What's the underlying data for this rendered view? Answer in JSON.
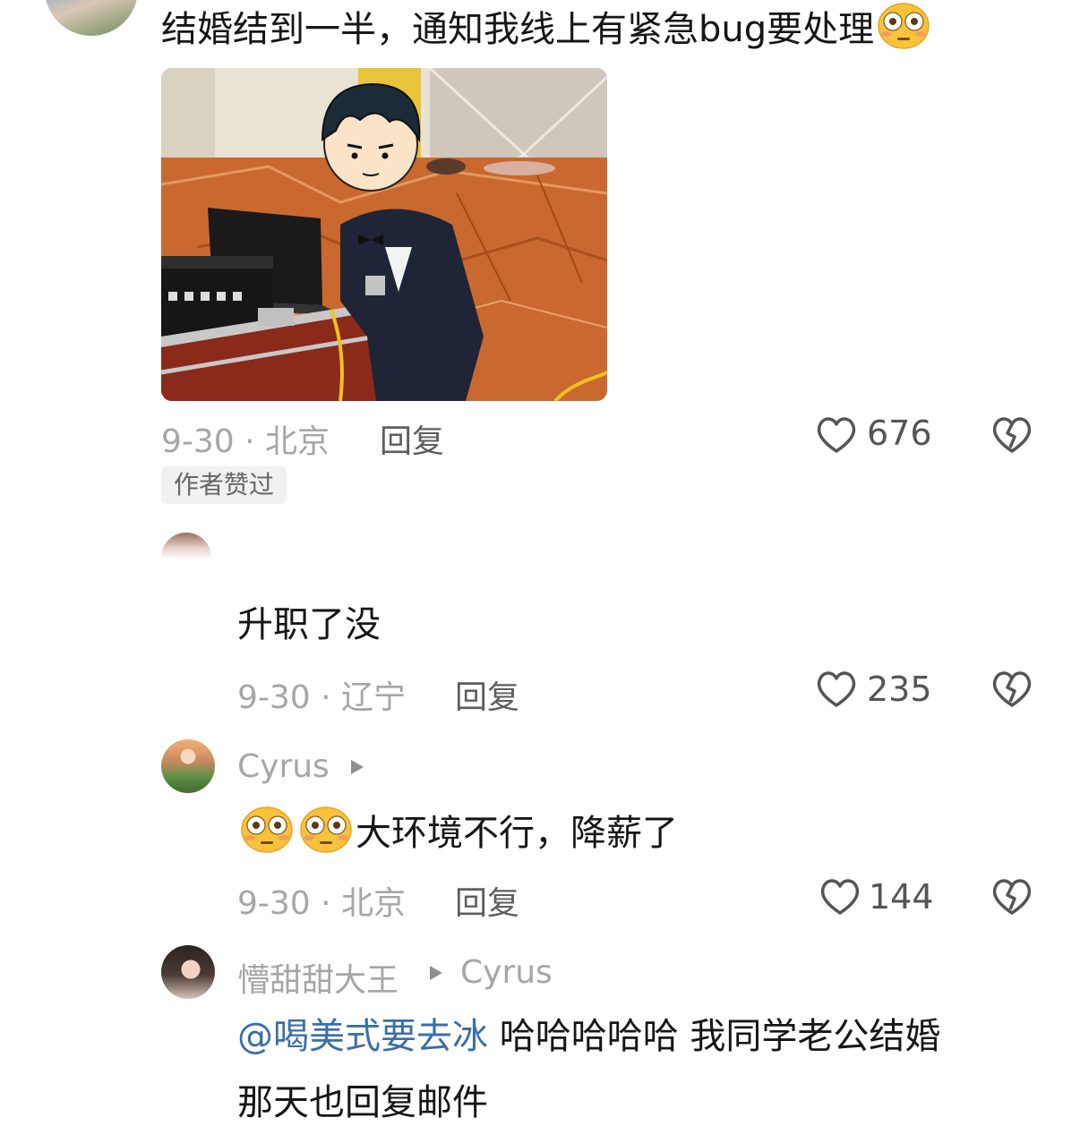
{
  "comments": [
    {
      "text": "结婚结到一半，通知我线上有紧急bug要处理",
      "emoji": "flushed-face",
      "meta": "9-30 · 北京",
      "reply_label": "回复",
      "likes": "676",
      "tag": "作者赞过",
      "has_image": true
    },
    {
      "text": "升职了没",
      "meta": "9-30 · 辽宁",
      "reply_label": "回复",
      "likes": "235"
    },
    {
      "username": "Cyrus",
      "text": "大环境不行，降薪了",
      "emoji": "flushed-face",
      "meta": "9-30 · 北京",
      "reply_label": "回复",
      "likes": "144"
    },
    {
      "username": "懵甜甜大王",
      "reply_to": "Cyrus",
      "mention": "@喝美式要去冰",
      "text_line1": "哈哈哈哈哈 我同学老公结婚",
      "text_line2": "那天也回复邮件"
    }
  ],
  "icons": [
    "heart-icon",
    "broken-heart-icon",
    "reply-arrow-icon",
    "flushed-face-emoji"
  ],
  "colors": {
    "mention": "#3a6ea8",
    "meta": "#a6a6a6",
    "text": "#161616"
  }
}
